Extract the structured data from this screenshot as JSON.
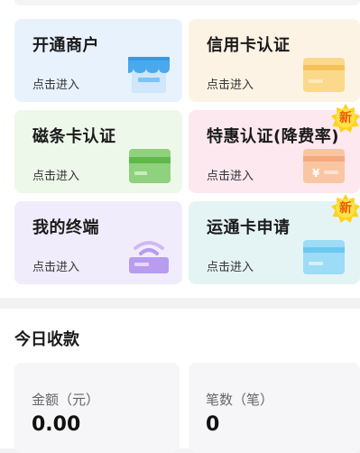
{
  "cards": [
    {
      "title": "开通商户",
      "sub": "点击进入",
      "icon": "storefront-icon",
      "bg": "#e7f2fd"
    },
    {
      "title": "信用卡认证",
      "sub": "点击进入",
      "icon": "credit-card-icon",
      "bg": "#fdf3e4"
    },
    {
      "title": "磁条卡认证",
      "sub": "点击进入",
      "icon": "magstripe-card-icon",
      "bg": "#eef8ea"
    },
    {
      "title": "特惠认证(降费率)",
      "sub": "点击进入",
      "icon": "yen-card-icon",
      "bg": "#fde8f0",
      "badge": "新"
    },
    {
      "title": "我的终端",
      "sub": "点击进入",
      "icon": "wireless-terminal-icon",
      "bg": "#f1ecfb"
    },
    {
      "title": "运通卡申请",
      "sub": "点击进入",
      "icon": "amex-card-icon",
      "bg": "#e4f4f5",
      "badge": "新"
    }
  ],
  "today": {
    "title": "今日收款",
    "amount_label": "金额（元）",
    "amount_value": "0.00",
    "count_label": "笔数（笔）",
    "count_value": "0"
  }
}
